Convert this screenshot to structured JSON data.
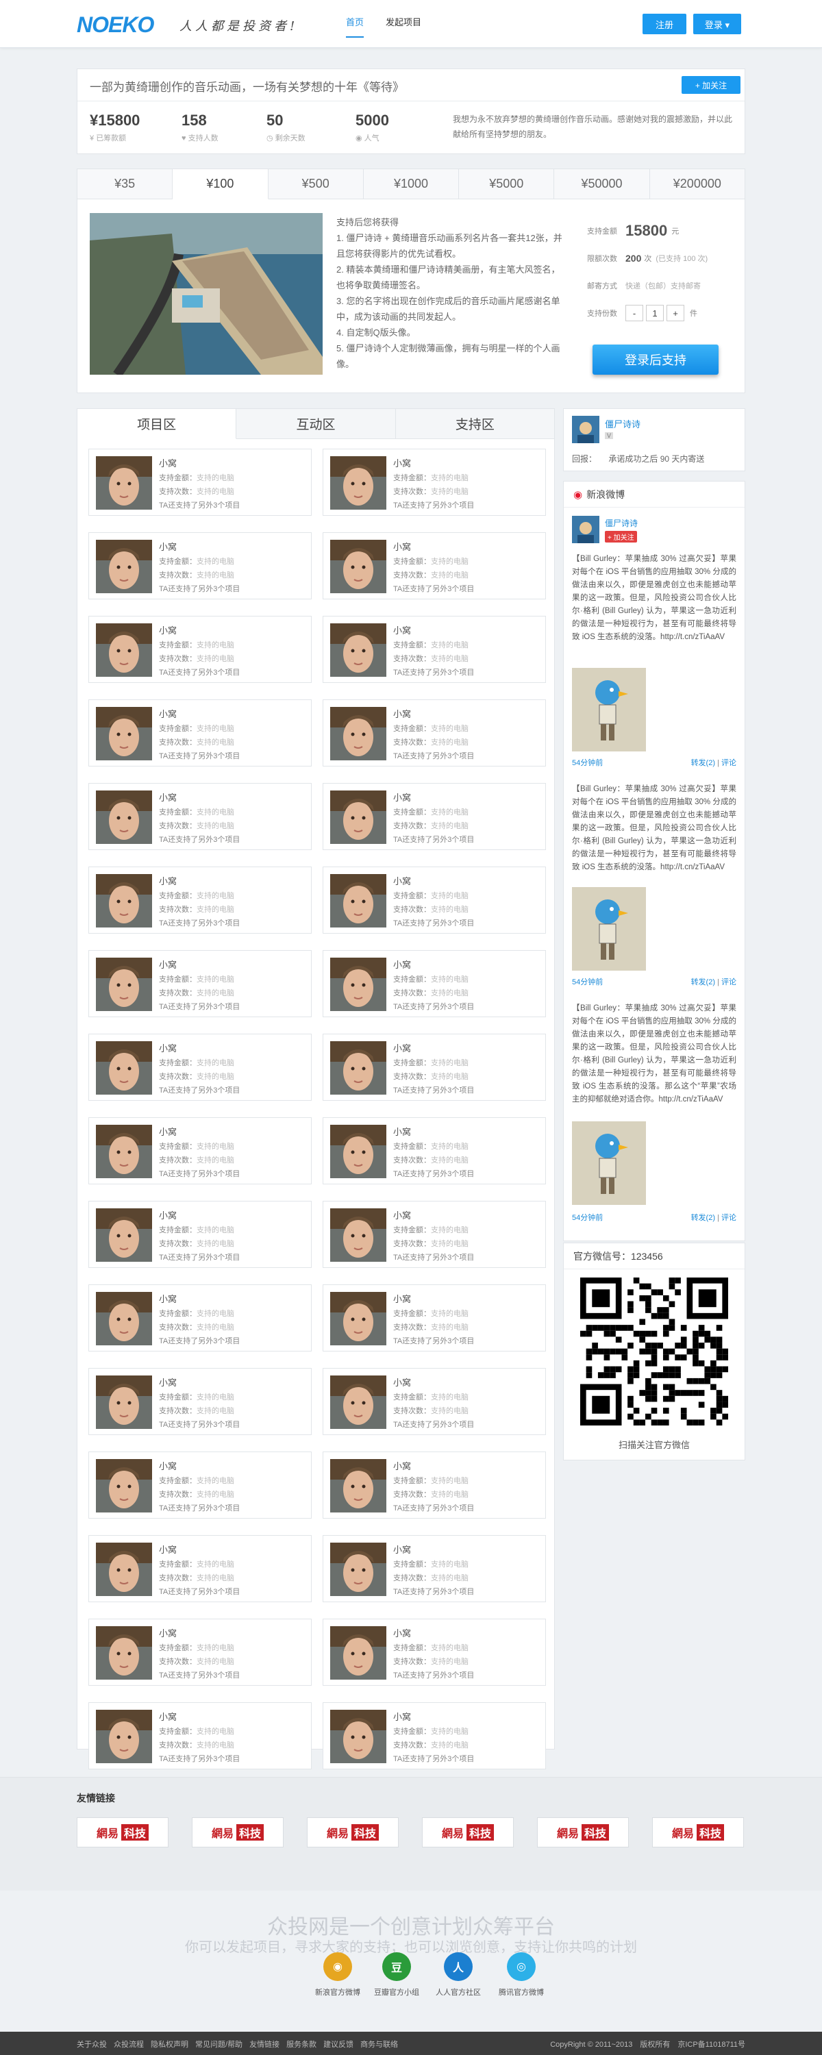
{
  "header": {
    "logo": "NOEKO",
    "slogan": "人人都是投资者!",
    "nav": [
      "首页",
      "发起项目"
    ],
    "register": "注册",
    "login": "登录 ▾"
  },
  "project": {
    "title": "一部为黄绮珊创作的音乐动画，一场有关梦想的十年《等待》",
    "follow_label": "+ 加关注",
    "stats": [
      {
        "value": "¥15800",
        "label": "已筹款额"
      },
      {
        "value": "158",
        "label": "支持人数"
      },
      {
        "value": "50",
        "label": "剩余天数"
      },
      {
        "value": "5000",
        "label": "人气"
      }
    ],
    "description": "我想为永不放弃梦想的黄绮珊创作音乐动画。感谢她对我的震撼激励，并以此献给所有坚持梦想的朋友。"
  },
  "tiers": {
    "tabs": [
      "¥35",
      "¥100",
      "¥500",
      "¥1000",
      "¥5000",
      "¥50000",
      "¥200000"
    ],
    "reward_title": "支持后您将获得",
    "reward_items": [
      "1. 僵尸诗诗 + 黄绮珊音乐动画系列名片各一套共12张，并且您将获得影片的优先试看权。",
      "2. 精装本黄绮珊和僵尸诗诗精美画册，有主笔大风签名，也将争取黄绮珊签名。",
      "3. 您的名字将出现在创作完成后的音乐动画片尾感谢名单中，成为该动画的共同发起人。",
      "4. 自定制Q版头像。",
      "5. 僵尸诗诗个人定制微薄画像，拥有与明星一样的个人画像。"
    ],
    "amount_label": "支持金额",
    "amount_value": "15800",
    "amount_unit": "元",
    "limit_label": "限额次数",
    "limit_value": "200",
    "limit_unit": "次",
    "limit_note": "(已支持 100 次)",
    "shipping_label": "邮寄方式",
    "shipping_value": "快递（包邮）支持邮寄",
    "count_label": "支持份数",
    "qty_minus": "-",
    "qty_value": "1",
    "qty_plus": "+",
    "qty_unit": "件",
    "support_button": "登录后支持"
  },
  "main_tabs": [
    "项目区",
    "互动区",
    "支持区"
  ],
  "supporter": {
    "name": "小窝",
    "amount_label": "支持金额：",
    "amount_value": "支持的电脑",
    "count_label": "支持次数：",
    "count_value": "支持的电脑",
    "note": "TA还支持了另外3个项目"
  },
  "creator": {
    "name": "僵尸诗诗",
    "badge": "V",
    "reward_label": "回报：",
    "reward_value": "承诺成功之后 90 天内寄送"
  },
  "weibo": {
    "heading": "新浪微博",
    "user": "僵尸诗诗",
    "follow": "+ 加关注",
    "tweets": [
      {
        "text": "【Bill Gurley：苹果抽成 30% 过高欠妥】苹果对每个在 iOS 平台销售的应用抽取 30% 分成的做法由来以久，即便是雅虎创立也未能撼动苹果的这一政策。但是，风险投资公司合伙人比尔·格利 (Bill Gurley) 认为，苹果这一急功近利的做法是一种短视行为，甚至有可能最终将导致 iOS 生态系统的没落。http://t.cn/zTiAaAV",
        "time": "54分钟前",
        "repost": "转发(2)",
        "comment": "评论"
      },
      {
        "text": "【Bill Gurley：苹果抽成 30% 过高欠妥】苹果对每个在 iOS 平台销售的应用抽取 30% 分成的做法由来以久，即便是雅虎创立也未能撼动苹果的这一政策。但是，风险投资公司合伙人比尔·格利 (Bill Gurley) 认为，苹果这一急功近利的做法是一种短视行为，甚至有可能最终将导致 iOS 生态系统的没落。http://t.cn/zTiAaAV",
        "time": "54分钟前",
        "repost": "转发(2)",
        "comment": "评论"
      },
      {
        "text": "【Bill Gurley：苹果抽成 30% 过高欠妥】苹果对每个在 iOS 平台销售的应用抽取 30% 分成的做法由来以久，即便是雅虎创立也未能撼动苹果的这一政策。但是，风险投资公司合伙人比尔·格利 (Bill Gurley) 认为，苹果这一急功近利的做法是一种短视行为，甚至有可能最终将导致 iOS 生态系统的没落。那么这个“苹果”农场主的抑郁就绝对适合你。http://t.cn/zTiAaAV",
        "time": "54分钟前",
        "repost": "转发(2)",
        "comment": "评论"
      }
    ]
  },
  "wechat": {
    "heading": "官方微信号：123456",
    "label": "扫描关注官方微信"
  },
  "footer": {
    "links_title": "友情链接",
    "partner_a": "網易",
    "partner_b": "科技",
    "slogan_main": "众投网是一个创意计划众筹平台",
    "slogan_sub": "你可以发起项目，寻求大家的支持；也可以浏览创意，支持让你共鸣的计划",
    "social": [
      {
        "label": "新浪官方微博",
        "icon": "weibo-icon",
        "color": "#e6a620"
      },
      {
        "label": "豆瓣官方小组",
        "icon": "douban-icon",
        "color": "#2a9b3a"
      },
      {
        "label": "人人官方社区",
        "icon": "renren-icon",
        "color": "#1b7fd0"
      },
      {
        "label": "腾讯官方微博",
        "icon": "tencent-icon",
        "color": "#2cb0e8"
      }
    ],
    "bottom_links": [
      "关于众投",
      "众投流程",
      "隐私权声明",
      "常见问题/帮助",
      "友情链接",
      "服务条款",
      "建议反馈",
      "商务与联络"
    ],
    "copyright": "CopyRight © 2011~2013　版权所有　京ICP备11018711号"
  }
}
